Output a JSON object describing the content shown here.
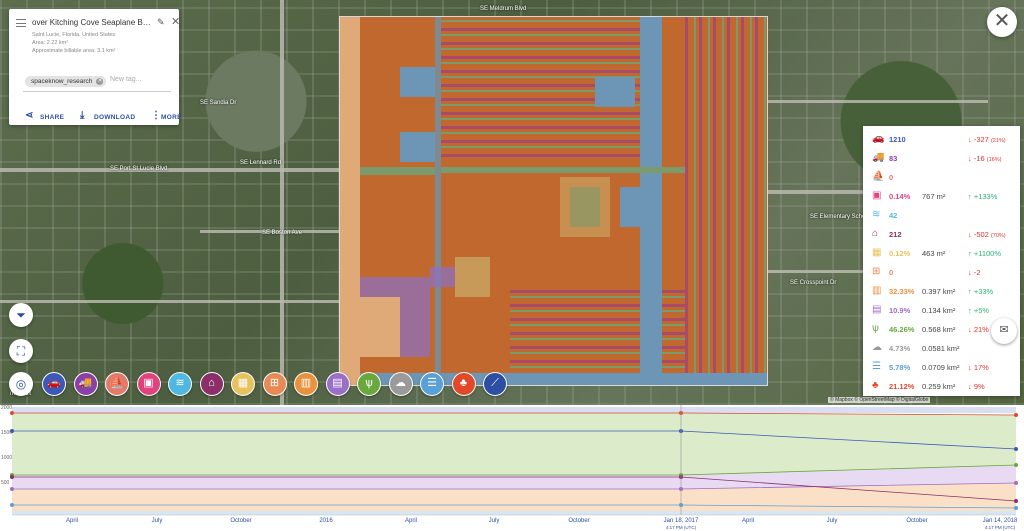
{
  "info_card": {
    "title": "over Kitching Cove Seaplane Base...",
    "location": "Saint Lucie, Florida, United States",
    "area": "Area: 2.22 km²",
    "billable": "Approximate billable area: 3.1 km²",
    "tag": "spaceknow_research",
    "new_tag_placeholder": "New tag...",
    "share_label": "SHARE",
    "download_label": "DOWNLOAD",
    "more_label": "MORE"
  },
  "map_labels": {
    "street_1": "SE Meldrum Blvd",
    "street_2": "SE Port St Lucie Blvd",
    "street_3": "SE Boston Ave",
    "street_4": "SE Sandia Dr",
    "street_5": "SE Crosspoint Dr",
    "street_6": "SE Lennard Rd",
    "street_7": "SE Elementary School",
    "mapbox": "mapbox",
    "attribution": "© Mapbox © OpenStreetMap © DigitalGlobe"
  },
  "stats": [
    {
      "icon": "car-icon",
      "glyph": "🚗",
      "color": "#3d58b8",
      "value": "1210",
      "area": "",
      "dir": "down",
      "change": "-327",
      "pct": "(21%)"
    },
    {
      "icon": "truck-icon",
      "glyph": "🚚",
      "color": "#8b3fa8",
      "value": "83",
      "area": "",
      "dir": "down",
      "change": "-16",
      "pct": "(16%)"
    },
    {
      "icon": "boat-icon",
      "glyph": "⛵",
      "color": "#e37a6b",
      "value": "0",
      "area": "",
      "dir": "",
      "change": "",
      "pct": ""
    },
    {
      "icon": "container-icon",
      "glyph": "▣",
      "color": "#e0427e",
      "value": "0.14%",
      "area": "767 m²",
      "dir": "up",
      "change": "+133%",
      "pct": ""
    },
    {
      "icon": "pool-icon",
      "glyph": "≋",
      "color": "#4fb8e0",
      "value": "42",
      "area": "",
      "dir": "",
      "change": "",
      "pct": ""
    },
    {
      "icon": "house-icon",
      "glyph": "⌂",
      "color": "#8b2f6a",
      "value": "212",
      "area": "",
      "dir": "down",
      "change": "-502",
      "pct": "(70%)"
    },
    {
      "icon": "construction-icon",
      "glyph": "▦",
      "color": "#e8c25e",
      "value": "0.12%",
      "area": "463 m²",
      "dir": "up",
      "change": "+1100%",
      "pct": ""
    },
    {
      "icon": "building-grid-icon",
      "glyph": "⊞",
      "color": "#e88a55",
      "value": "0",
      "area": "",
      "dir": "down",
      "change": "-2",
      "pct": ""
    },
    {
      "icon": "industrial-icon",
      "glyph": "▥",
      "color": "#e8923e",
      "value": "32.33%",
      "area": "0.397 km²",
      "dir": "up",
      "change": "+33%",
      "pct": ""
    },
    {
      "icon": "book-icon",
      "glyph": "▤",
      "color": "#9a6fc8",
      "value": "10.9%",
      "area": "0.134 km²",
      "dir": "up",
      "change": "+5%",
      "pct": ""
    },
    {
      "icon": "grass-icon",
      "glyph": "ѱ",
      "color": "#6aa83e",
      "value": "46.26%",
      "area": "0.568 km²",
      "dir": "down",
      "change": "21%",
      "pct": ""
    },
    {
      "icon": "cloud-icon",
      "glyph": "☁",
      "color": "#9a9a9a",
      "value": "4.73%",
      "area": "0.0581 km²",
      "dir": "",
      "change": "",
      "pct": ""
    },
    {
      "icon": "water-icon",
      "glyph": "☰",
      "color": "#5aa0d8",
      "value": "5.78%",
      "area": "0.0709 km²",
      "dir": "down",
      "change": "17%",
      "pct": ""
    },
    {
      "icon": "tree-icon",
      "glyph": "♣",
      "color": "#e04a2a",
      "value": "21.12%",
      "area": "0.259 km²",
      "dir": "down",
      "change": "9%",
      "pct": ""
    }
  ],
  "layer_buttons": [
    {
      "name": "layer-car-button",
      "glyph": "🚗",
      "color": "#3d58b8"
    },
    {
      "name": "layer-truck-button",
      "glyph": "🚚",
      "color": "#8b3fa8"
    },
    {
      "name": "layer-boat-button",
      "glyph": "⛵",
      "color": "#e37a6b"
    },
    {
      "name": "layer-container-button",
      "glyph": "▣",
      "color": "#e0427e"
    },
    {
      "name": "layer-pool-button",
      "glyph": "≋",
      "color": "#4fb8e0"
    },
    {
      "name": "layer-house-button",
      "glyph": "⌂",
      "color": "#8b2f6a"
    },
    {
      "name": "layer-construction-button",
      "glyph": "▦",
      "color": "#e8c25e"
    },
    {
      "name": "layer-building-button",
      "glyph": "⊞",
      "color": "#e88a55"
    },
    {
      "name": "layer-industrial-button",
      "glyph": "▥",
      "color": "#e8923e"
    },
    {
      "name": "layer-book-button",
      "glyph": "▤",
      "color": "#9a6fc8"
    },
    {
      "name": "layer-grass-button",
      "glyph": "ѱ",
      "color": "#6aa83e"
    },
    {
      "name": "layer-cloud-button",
      "glyph": "☁",
      "color": "#9a9a9a"
    },
    {
      "name": "layer-water-button",
      "glyph": "☰",
      "color": "#5aa0d8"
    },
    {
      "name": "layer-tree-button",
      "glyph": "♣",
      "color": "#e04a2a"
    },
    {
      "name": "layer-crop-button",
      "glyph": "⟋",
      "color": "#2c4fa3"
    }
  ],
  "timeline": {
    "x_labels": [
      "April",
      "July",
      "October",
      "2016",
      "April",
      "July",
      "October",
      "Jan 18, 2017",
      "April",
      "July",
      "October",
      "Jan 14, 2018"
    ],
    "sub_labels": [
      "4:17 PM (UTC)",
      "4:17 PM (UTC)"
    ],
    "y_ticks": [
      "2000",
      "1500",
      "1000",
      "500"
    ],
    "colors": {
      "green": "#6aa83e",
      "purple": "#9a6fc8",
      "orange": "#e8923e",
      "blue": "#3d58b8",
      "red": "#e04a2a",
      "sky": "#5aa0d8"
    }
  },
  "chart_data": {
    "type": "area",
    "x": [
      "Jan 18, 2017",
      "Jan 14, 2018"
    ],
    "series": [
      {
        "name": "Grass",
        "values": [
          58.6,
          46.26
        ]
      },
      {
        "name": "Industrial",
        "values": [
          24.3,
          32.33
        ]
      },
      {
        "name": "Book",
        "values": [
          10.4,
          10.9
        ]
      },
      {
        "name": "Cars",
        "values": [
          1537,
          1210
        ]
      },
      {
        "name": "Houses",
        "values": [
          714,
          212
        ]
      }
    ]
  }
}
